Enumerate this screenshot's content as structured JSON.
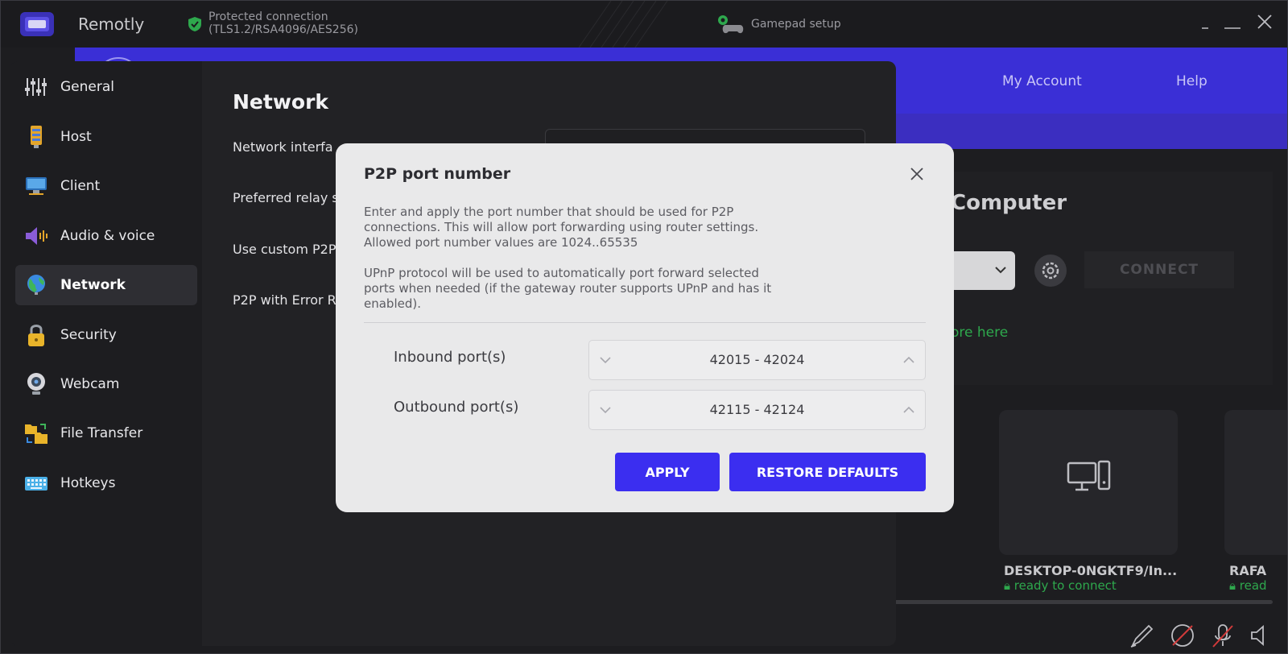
{
  "app": {
    "title": "Remotly",
    "connection_line1": "Protected connection",
    "connection_line2": "(TLS1.2/RSA4096/AES256)",
    "gamepad_label": "Gamepad setup"
  },
  "background": {
    "nav_links": [
      "My Account",
      "Help"
    ],
    "heading": "Computer",
    "connect_label": "CONNECT",
    "more_link": "ore here",
    "cards": [
      {
        "title": "DESKTOP-0NGKTF9/In...",
        "status": "ready to connect"
      },
      {
        "title": "RAFA",
        "status": "read"
      }
    ]
  },
  "settings": {
    "sidebar": [
      {
        "label": "General",
        "icon": "sliders-icon"
      },
      {
        "label": "Host",
        "icon": "server-icon"
      },
      {
        "label": "Client",
        "icon": "monitor-icon"
      },
      {
        "label": "Audio & voice",
        "icon": "speaker-icon"
      },
      {
        "label": "Network",
        "icon": "globe-icon"
      },
      {
        "label": "Security",
        "icon": "lock-icon"
      },
      {
        "label": "Webcam",
        "icon": "webcam-icon"
      },
      {
        "label": "File Transfer",
        "icon": "folders-icon"
      },
      {
        "label": "Hotkeys",
        "icon": "keyboard-icon"
      }
    ],
    "active_item": "Network",
    "section_title": "Network",
    "rows": [
      "Network interfa",
      "Preferred relay s",
      "Use custom P2P",
      "P2P with Error R"
    ]
  },
  "dialog": {
    "title": "P2P port number",
    "paragraph1": [
      "Enter and apply the port number that should be used for P2P",
      "connections. This will allow port forwarding using router settings.",
      "Allowed port number values are 1024..65535"
    ],
    "paragraph2": [
      "UPnP protocol will be used to automatically port forward selected",
      "ports when needed (if the gateway router supports UPnP and has it",
      "enabled)."
    ],
    "inbound_label": "Inbound port(s)",
    "inbound_value": "42015 - 42024",
    "outbound_label": "Outbound port(s)",
    "outbound_value": "42115 - 42124",
    "apply_label": "APPLY",
    "restore_label": "RESTORE DEFAULTS"
  },
  "colors": {
    "accent": "#3b2ef0",
    "nav_bg": "#3a2fd6",
    "status_green": "#2ea84d",
    "dialog_bg": "#e9e9ea"
  }
}
